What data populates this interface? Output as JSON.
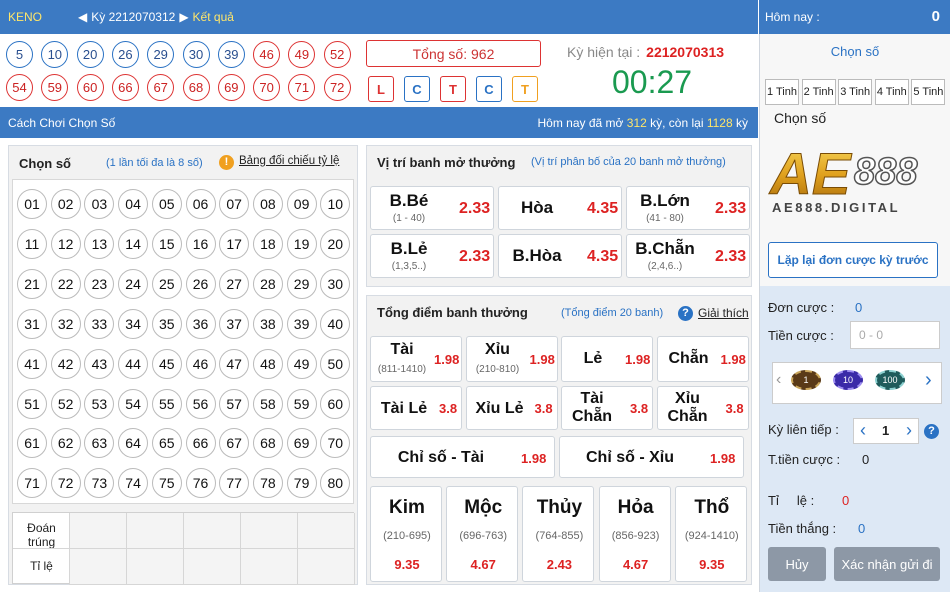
{
  "top": {
    "game": "KENO",
    "ky": "Kỳ 2212070312",
    "result": "Kết quả"
  },
  "right_top": {
    "label": "Hôm nay :",
    "value": "0"
  },
  "drawn": {
    "blue": [
      "5",
      "10",
      "20",
      "26",
      "29",
      "30",
      "39"
    ],
    "red1": [
      "46",
      "49",
      "52"
    ],
    "red2": [
      "54",
      "59",
      "60",
      "66",
      "67",
      "68",
      "69",
      "70",
      "71",
      "72"
    ]
  },
  "total": "Tổng số: 962",
  "letters": [
    {
      "t": "L",
      "c": "#d33"
    },
    {
      "t": "C",
      "c": "#2a72c4"
    },
    {
      "t": "T",
      "c": "#d33"
    },
    {
      "t": "C",
      "c": "#2a72c4"
    },
    {
      "t": "T",
      "c": "#f0a020"
    }
  ],
  "ky_now": {
    "label": "Kỳ hiện tại :",
    "value": "2212070313"
  },
  "timer": "00:27",
  "subbar": {
    "left": "Cách Chơi Chọn Số",
    "pre": "Hôm nay đã mở",
    "opened": "312",
    "mid": "kỳ, còn lại",
    "remain": "1128",
    "suf": "kỳ"
  },
  "chon": {
    "title": "Chọn số",
    "hint": "(1 lần tối đa là 8 số)",
    "info": "!",
    "table_link": "Bảng đối chiếu tỷ lệ",
    "doan": "Đoán trúng",
    "tile": "Tỉ lệ"
  },
  "numbers": [
    "01",
    "02",
    "03",
    "04",
    "05",
    "06",
    "07",
    "08",
    "09",
    "10",
    "11",
    "12",
    "13",
    "14",
    "15",
    "16",
    "17",
    "18",
    "19",
    "20",
    "21",
    "22",
    "23",
    "24",
    "25",
    "26",
    "27",
    "28",
    "29",
    "30",
    "31",
    "32",
    "33",
    "34",
    "35",
    "36",
    "37",
    "38",
    "39",
    "40",
    "41",
    "42",
    "43",
    "44",
    "45",
    "46",
    "47",
    "48",
    "49",
    "50",
    "51",
    "52",
    "53",
    "54",
    "55",
    "56",
    "57",
    "58",
    "59",
    "60",
    "61",
    "62",
    "63",
    "64",
    "65",
    "66",
    "67",
    "68",
    "69",
    "70",
    "71",
    "72",
    "73",
    "74",
    "75",
    "76",
    "77",
    "78",
    "79",
    "80"
  ],
  "vitri": {
    "title": "Vị trí banh mở thưởng",
    "hint": "(Vị trí phân bố của 20 banh mở thưởng)",
    "items": [
      {
        "n": "B.Bé",
        "s": "(1 - 40)",
        "o": "2.33"
      },
      {
        "n": "Hòa",
        "s": "",
        "o": "4.35"
      },
      {
        "n": "B.Lớn",
        "s": "(41 - 80)",
        "o": "2.33"
      },
      {
        "n": "B.Lẻ",
        "s": "(1,3,5..)",
        "o": "2.33"
      },
      {
        "n": "B.Hòa",
        "s": "",
        "o": "4.35"
      },
      {
        "n": "B.Chẵn",
        "s": "(2,4,6..)",
        "o": "2.33"
      }
    ]
  },
  "tongdiem": {
    "title": "Tổng điểm banh thưởng",
    "hint": "(Tổng điểm 20 banh)",
    "help": "?",
    "link": "Giải thích",
    "row1": [
      {
        "n": "Tài",
        "s": "(811-1410)",
        "o": "1.98"
      },
      {
        "n": "Xỉu",
        "s": "(210-810)",
        "o": "1.98"
      },
      {
        "n": "Lẻ",
        "s": "",
        "o": "1.98"
      },
      {
        "n": "Chẵn",
        "s": "",
        "o": "1.98"
      }
    ],
    "row2": [
      {
        "n": "Tài Lẻ",
        "o": "3.8"
      },
      {
        "n": "Xỉu Lẻ",
        "o": "3.8"
      },
      {
        "n": "Tài Chẵn",
        "o": "3.8"
      },
      {
        "n": "Xỉu Chẵn",
        "o": "3.8"
      }
    ],
    "row3": [
      {
        "n": "Chỉ số - Tài",
        "o": "1.98"
      },
      {
        "n": "Chỉ số - Xỉu",
        "o": "1.98"
      }
    ],
    "row4": [
      {
        "n": "Kim",
        "s": "(210-695)",
        "o": "9.35"
      },
      {
        "n": "Mộc",
        "s": "(696-763)",
        "o": "4.67"
      },
      {
        "n": "Thủy",
        "s": "(764-855)",
        "o": "2.43"
      },
      {
        "n": "Hỏa",
        "s": "(856-923)",
        "o": "4.67"
      },
      {
        "n": "Thổ",
        "s": "(924-1410)",
        "o": "9.35"
      }
    ]
  },
  "right": {
    "chon": "Chọn số",
    "tinh": [
      "1 Tinh",
      "2 Tinh",
      "3 Tinh",
      "4 Tinh",
      "5 Tinh"
    ],
    "chon2": "Chọn số",
    "logo_main": "AE888",
    "logo_sub": "AE888.DIGITAL",
    "lap": "Lặp lại đơn cược kỳ trước",
    "don_cuoc": "Đơn cược :",
    "don_val": "0",
    "tien_cuoc": "Tiền cược :",
    "tien_ph": "0 - 0",
    "chips": [
      "1",
      "10",
      "100"
    ],
    "ky_lt": "Kỳ liên tiếp :",
    "ky_val": "1",
    "ttien": "T.tiền cược :",
    "ttien_val": "0",
    "tile": "Tỉ     lệ :",
    "tile_val": "0",
    "tthang": "Tiền thắng :",
    "tthang_val": "0",
    "huy": "Hủy",
    "xn": "Xác nhận gửi đi"
  }
}
